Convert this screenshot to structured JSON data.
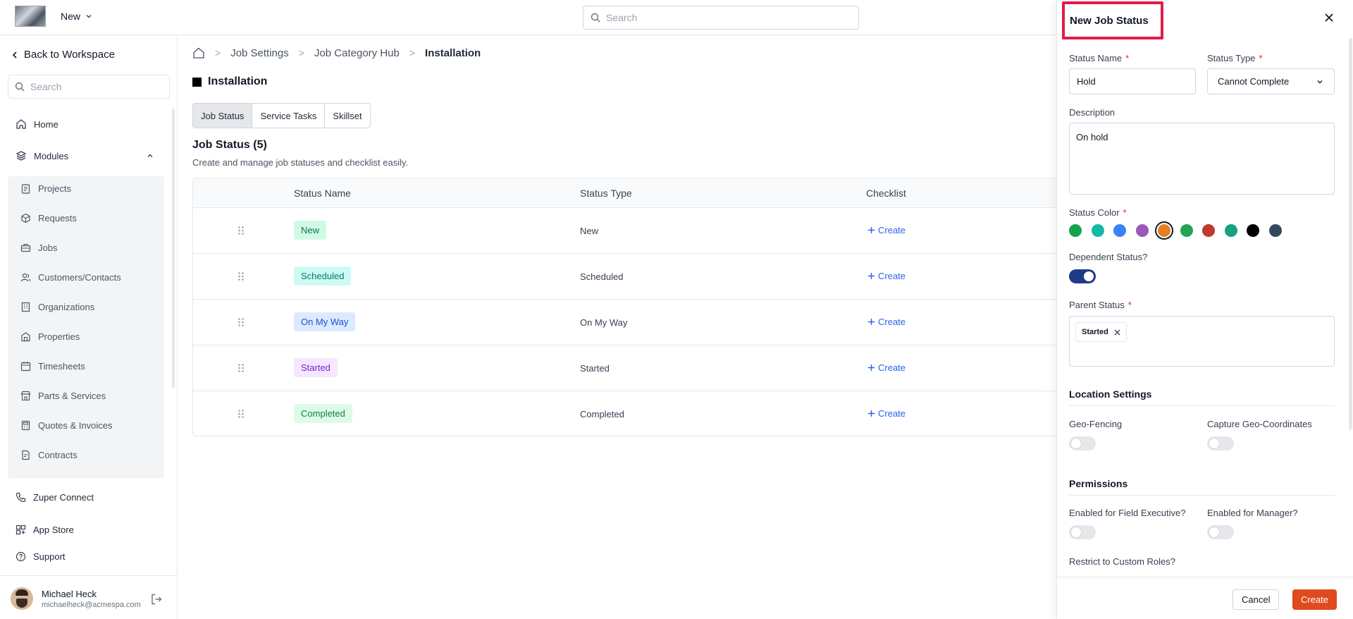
{
  "topbar": {
    "new_label": "New",
    "search_placeholder": "Search"
  },
  "sidebar": {
    "back_label": "Back to Workspace",
    "search_placeholder": "Search",
    "home_label": "Home",
    "modules_label": "Modules",
    "modules": [
      "Projects",
      "Requests",
      "Jobs",
      "Customers/Contacts",
      "Organizations",
      "Properties",
      "Timesheets",
      "Parts & Services",
      "Quotes & Invoices",
      "Contracts"
    ],
    "zuper_connect_label": "Zuper Connect",
    "app_store_label": "App Store",
    "support_label": "Support",
    "user": {
      "name": "Michael Heck",
      "email": "michaelheck@acmespa.com"
    }
  },
  "breadcrumb": [
    "Job Settings",
    "Job Category Hub",
    "Installation"
  ],
  "page": {
    "title": "Installation",
    "tabs": [
      "Job Status",
      "Service Tasks",
      "Skillset"
    ],
    "section_title": "Job Status (5)",
    "section_subtitle": "Create and manage job statuses and checklist easily."
  },
  "table": {
    "headers": {
      "status_name": "Status Name",
      "status_type": "Status Type",
      "checklist": "Checklist"
    },
    "rows": [
      {
        "name": "New",
        "type": "New",
        "checklist": "Create",
        "bg": "#d1fae5",
        "fg": "#047857"
      },
      {
        "name": "Scheduled",
        "type": "Scheduled",
        "checklist": "Create",
        "bg": "#ccfbf1",
        "fg": "#0f766e"
      },
      {
        "name": "On My Way",
        "type": "On My Way",
        "checklist": "Create",
        "bg": "#dbeafe",
        "fg": "#1d4ed8"
      },
      {
        "name": "Started",
        "type": "Started",
        "checklist": "Create",
        "bg": "#f3e8ff",
        "fg": "#7e22ce"
      },
      {
        "name": "Completed",
        "type": "Completed",
        "checklist": "Create",
        "bg": "#dcfce7",
        "fg": "#15803d"
      }
    ]
  },
  "drawer": {
    "title": "New Job Status",
    "status_name_label": "Status Name",
    "status_name_value": "Hold",
    "status_type_label": "Status Type",
    "status_type_value": "Cannot Complete",
    "description_label": "Description",
    "description_value": "On hold",
    "status_color_label": "Status Color",
    "colors": [
      "#16a34a",
      "#14b8a6",
      "#3b82f6",
      "#9b59b6",
      "#e67e22",
      "#22a559",
      "#c0392b",
      "#16a085",
      "#000000",
      "#34495e"
    ],
    "selected_color": "#e67e22",
    "dependent_label": "Dependent Status?",
    "dependent_on": true,
    "parent_status_label": "Parent Status",
    "parent_status_chip": "Started",
    "location_title": "Location Settings",
    "geo_fencing_label": "Geo-Fencing",
    "capture_geo_label": "Capture Geo-Coordinates",
    "permissions_title": "Permissions",
    "field_exec_label": "Enabled for Field Executive?",
    "manager_label": "Enabled for Manager?",
    "restrict_label": "Restrict to Custom Roles?",
    "cancel_label": "Cancel",
    "create_label": "Create"
  }
}
